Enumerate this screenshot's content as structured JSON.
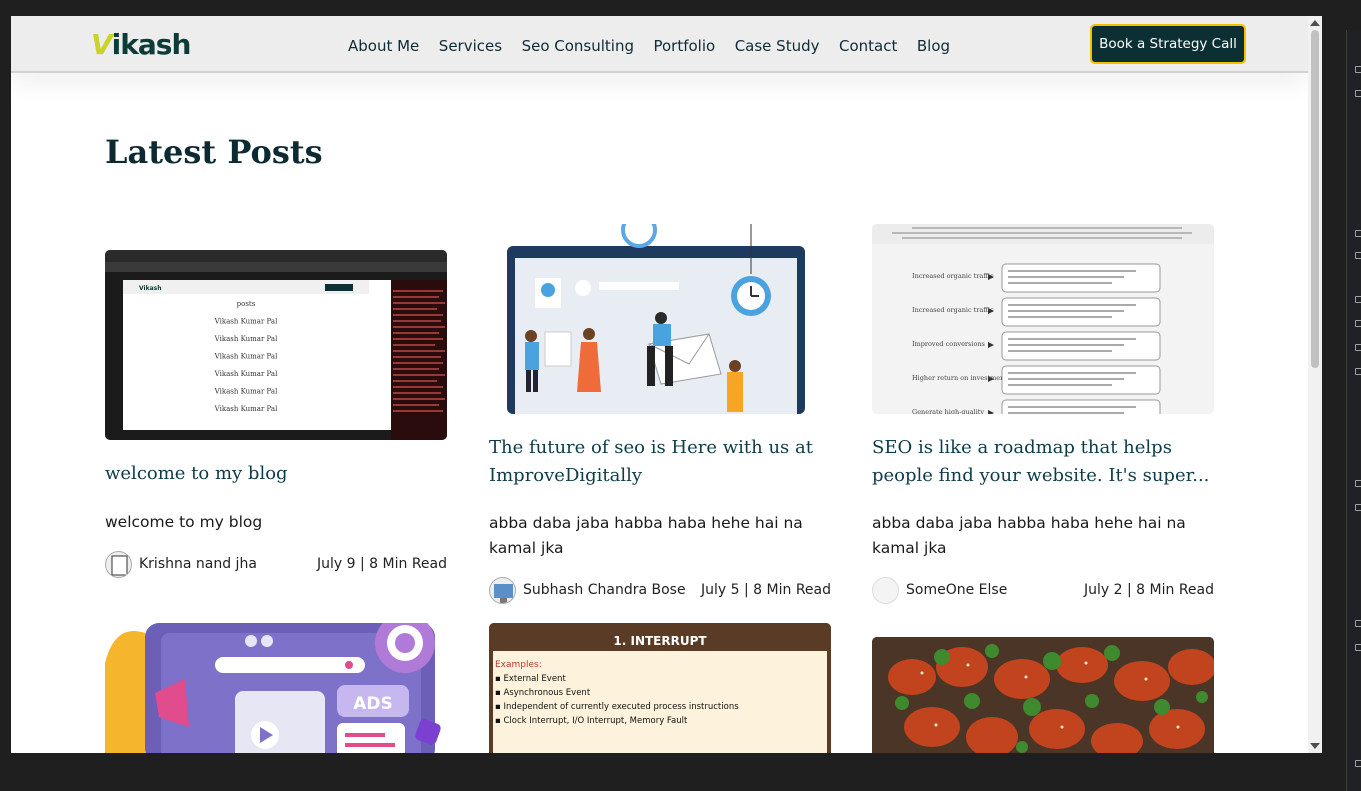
{
  "header": {
    "logo_text": "Vikash",
    "nav": [
      "About Me",
      "Services",
      "Seo Consulting",
      "Portfolio",
      "Case Study",
      "Contact",
      "Blog"
    ],
    "cta_label": "Book a Strategy Call"
  },
  "section_title": "Latest Posts",
  "posts": [
    {
      "title": "welcome to my blog",
      "excerpt": "welcome to my blog",
      "author": "Krishna nand jha",
      "date": "July 9 | 8 Min Read",
      "thumb_lines": [
        "posts",
        "Vikash Kumar Pal",
        "Vikash Kumar Pal",
        "Vikash Kumar Pal",
        "Vikash Kumar Pal",
        "Vikash Kumar Pal",
        "Vikash Kumar Pal"
      ],
      "thumb_logo": "Vikash"
    },
    {
      "title": "The future of seo is Here with us at ImproveDigitally",
      "excerpt": "abba daba jaba habba haba hehe hai na kamal jka",
      "author": "Subhash Chandra Bose",
      "date": "July 5 | 8 Min Read"
    },
    {
      "title": "SEO is like a roadmap that helps people find your website. It's super...",
      "excerpt": "abba daba jaba habba haba hehe hai na kamal jka",
      "author": "SomeOne Else",
      "date": "July 2 | 8 Min Read",
      "thumb_rows": [
        "Increased organic traffic",
        "Increased organic traffic",
        "Improved conversions",
        "Higher return on investment",
        "Generate high-quality"
      ]
    },
    {
      "thumb_badge": "ADS"
    },
    {
      "thumb_heading": "1. INTERRUPT",
      "thumb_subhead": "Examples:",
      "thumb_items": [
        "External Event",
        "Asynchronous Event",
        "Independent of currently executed process instructions",
        "Clock Interrupt, I/O Interrupt, Memory Fault"
      ]
    },
    {}
  ],
  "colors": {
    "brand": "#0b2f33",
    "accent": "#f2c200",
    "logo_v": "#c8d42a"
  }
}
